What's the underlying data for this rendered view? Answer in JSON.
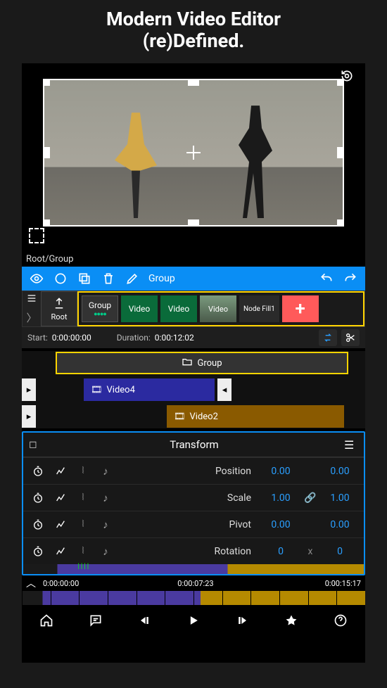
{
  "header": {
    "line1": "Modern Video Editor",
    "line2": "(re)Defined."
  },
  "breadcrumb": "Root/Group",
  "toolbar": {
    "edit_target": "Group"
  },
  "clip_row": {
    "root_label": "Root",
    "clips": [
      {
        "label": "Group",
        "kind": "group"
      },
      {
        "label": "Video",
        "kind": "video"
      },
      {
        "label": "Video",
        "kind": "video"
      },
      {
        "label": "Video",
        "kind": "thumb"
      },
      {
        "label": "Node Fill1",
        "kind": "nodefill"
      }
    ]
  },
  "timing": {
    "start_label": "Start:",
    "start_value": "0:00:00:00",
    "duration_label": "Duration:",
    "duration_value": "0:00:12:02"
  },
  "tracks": {
    "group_label": "Group",
    "video4_label": "Video4",
    "video2_label": "Video2"
  },
  "transform": {
    "title": "Transform",
    "rows": [
      {
        "name": "Position",
        "v1": "0.00",
        "mid": "",
        "v2": "0.00"
      },
      {
        "name": "Scale",
        "v1": "1.00",
        "mid": "link",
        "v2": "1.00"
      },
      {
        "name": "Pivot",
        "v1": "0.00",
        "mid": "",
        "v2": "0.00"
      },
      {
        "name": "Rotation",
        "v1": "0",
        "mid": "x",
        "v2": "0"
      }
    ]
  },
  "timeline": {
    "t1": "0:00:00:00",
    "t2": "0:00:07:23",
    "t3": "0:00:15:17"
  },
  "icons": {
    "eye": "eye",
    "circle": "circle",
    "copy": "copy",
    "trash": "trash",
    "pencil": "pencil",
    "undo": "undo",
    "redo": "redo",
    "share_up": "share-up",
    "plus": "+",
    "swap": "swap",
    "scissors": "scissors",
    "folder": "folder",
    "film": "film",
    "transform_corner": "corner-handles",
    "burger": "menu",
    "stopwatch": "stopwatch",
    "graph": "graph",
    "wave": "wave",
    "note": "note",
    "link": "link",
    "home": "home",
    "comment": "comment",
    "step_back": "step-back",
    "play": "play",
    "step_fwd": "step-fwd",
    "diamond": "diamond",
    "help": "help",
    "rotate": "rotate-reset",
    "fullscreen": "fullscreen",
    "list": "list",
    "chev_right": "chev-right",
    "chev_up": "chev-up",
    "tri_l": "◂",
    "tri_r": "▸"
  }
}
